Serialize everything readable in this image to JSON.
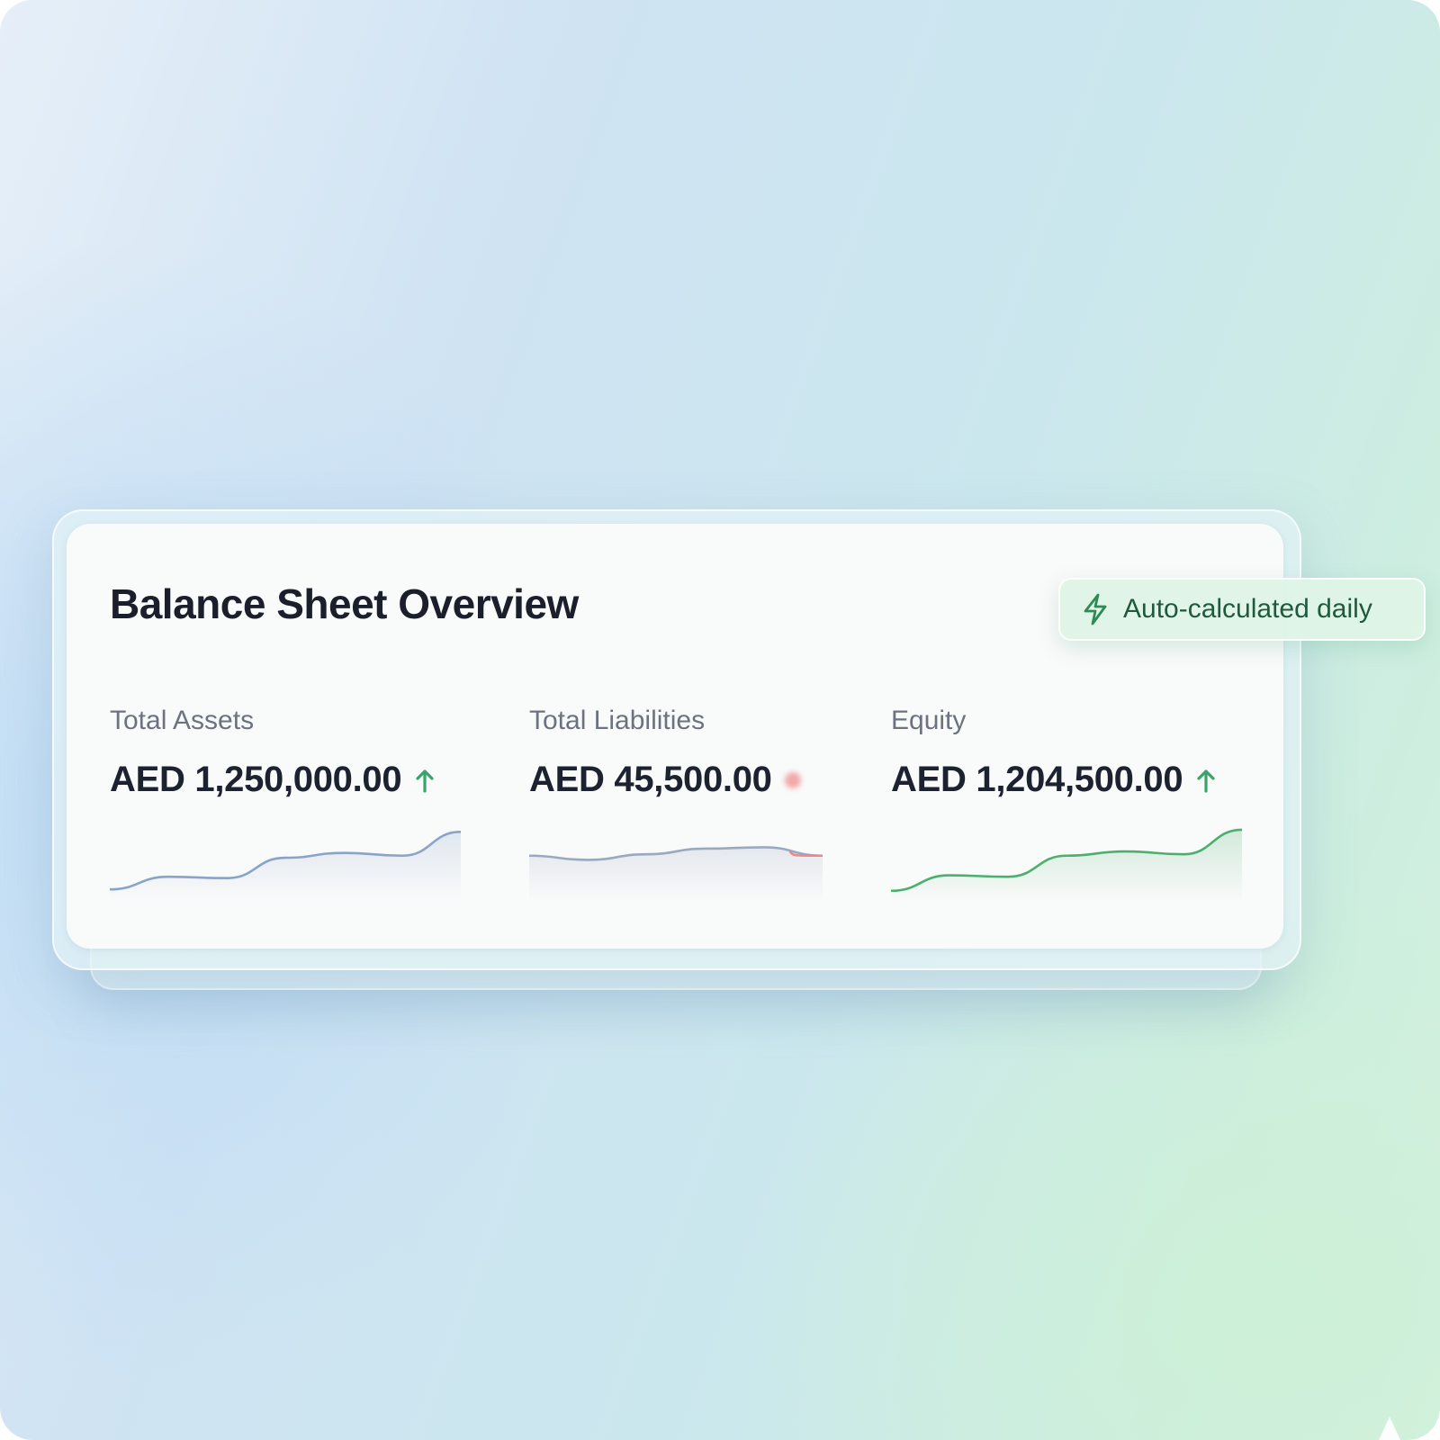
{
  "card": {
    "title": "Balance Sheet Overview"
  },
  "badge": {
    "icon": "lightning-bolt-icon",
    "label": "Auto-calculated daily",
    "color": "#2e8b57"
  },
  "metrics": [
    {
      "label": "Total Assets",
      "value": "AED 1,250,000.00",
      "trend": "up",
      "trend_icon": "arrow-up-icon",
      "color": "#8aa3c8",
      "sparkline": [
        0.1,
        0.28,
        0.26,
        0.55,
        0.62,
        0.58,
        0.92
      ]
    },
    {
      "label": "Total Liabilities",
      "value": "AED 45,500.00",
      "trend": "down",
      "trend_icon": "red-dot-indicator",
      "color": "#9aa9c0",
      "accent_color": "#e98a8a",
      "sparkline": [
        0.58,
        0.52,
        0.6,
        0.68,
        0.7,
        0.58
      ]
    },
    {
      "label": "Equity",
      "value": "AED 1,204,500.00",
      "trend": "up",
      "trend_icon": "arrow-up-icon",
      "color": "#4caf6e",
      "sparkline": [
        0.08,
        0.3,
        0.28,
        0.58,
        0.64,
        0.6,
        0.95
      ]
    }
  ],
  "colors": {
    "trend_up": "#3aa36a",
    "title": "#1a1f2b",
    "label": "#6b7280"
  }
}
